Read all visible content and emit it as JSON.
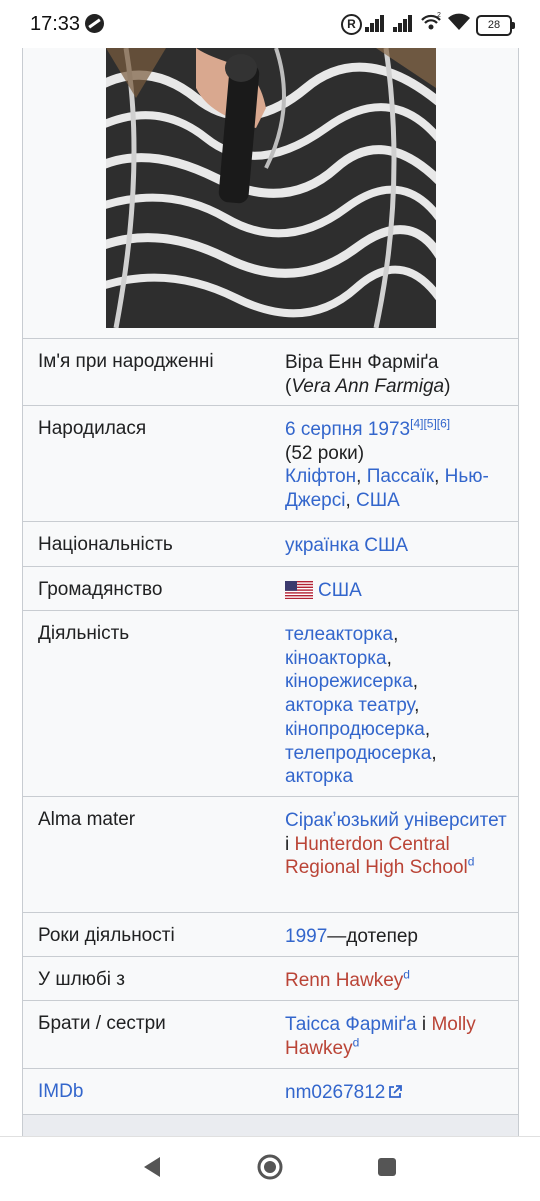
{
  "status_bar": {
    "time": "17:33",
    "battery": "28",
    "wifi_sup": "2",
    "registered_mark": "R"
  },
  "infobox": {
    "rows": [
      {
        "label": "Ім'я при народженні",
        "value_line1": "Віра Енн Фарміґа",
        "value_line2": "Vera Ann Farmiga"
      },
      {
        "label": "Народилася",
        "date_link": "6 серпня 1973",
        "refs": [
          "[4]",
          "[5]",
          "[6]"
        ],
        "age": "(52 роки)",
        "place_links": [
          "Кліфтон",
          "Пассаїк",
          "Нью-Джерсі",
          "США"
        ]
      },
      {
        "label": "Національність",
        "value": "українка США"
      },
      {
        "label": "Громадянство",
        "value": "США",
        "flag_icon": "us-flag-icon"
      },
      {
        "label": "Діяльність",
        "values": [
          "телеакторка",
          "кіноакторка",
          "кінорежисерка",
          "акторка театру",
          "кінопродюсерка",
          "телепродюсерка",
          "акторка"
        ]
      },
      {
        "label": "Alma mater",
        "link1": "Сіракʼюзький університет",
        "conj": "і",
        "link2": "Hunterdon Central Regional High School",
        "wikidata_mark": "d"
      },
      {
        "label": "Роки діяльності",
        "year_link": "1997",
        "rest": "—дотепер"
      },
      {
        "label": "У шлюбі з",
        "value": "Renn Hawkey",
        "wikidata_mark": "d"
      },
      {
        "label": "Брати / сестри",
        "link1": "Таісса Фарміґа",
        "conj": "і",
        "link2": "Molly Hawkey",
        "wikidata_mark": "d"
      },
      {
        "label": "IMDb",
        "value": "nm0267812",
        "ext_icon": "external-link-icon"
      }
    ]
  },
  "colors": {
    "link": "#3366cc",
    "redlink": "#ba4436",
    "infobox_bg": "#f8f9fa",
    "border": "#c8ccd1"
  }
}
